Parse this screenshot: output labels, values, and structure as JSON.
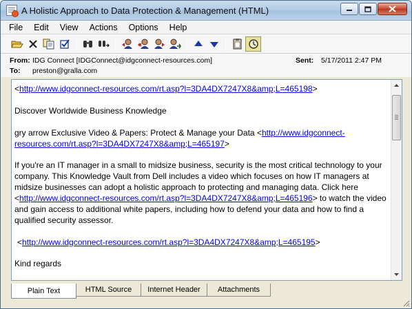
{
  "window": {
    "title": "A Holistic Approach to Data Protection & Management (HTML)",
    "controls": {
      "minimize": "—",
      "maximize": "▢",
      "close": "✕"
    }
  },
  "menu": [
    "File",
    "Edit",
    "View",
    "Actions",
    "Options",
    "Help"
  ],
  "toolbar": {
    "icons": [
      "open-folder-icon",
      "delete-icon",
      "copy-icon",
      "checkbox-icon",
      "search-binoculars-icon",
      "find-next-icon",
      "reply-icon",
      "reply-all-icon",
      "forward-icon",
      "forward-attach-icon",
      "previous-arrow-icon",
      "next-arrow-icon",
      "clipboard-icon",
      "clock-icon"
    ]
  },
  "header": {
    "from_label": "From:",
    "from_value": "IDG Connect  [IDGConnect@idgconnect-resources.com]",
    "to_label": "To:",
    "to_value": "preston@gralla.com",
    "sent_label": "Sent:",
    "sent_value": "5/17/2011 2:47 PM"
  },
  "body": {
    "link1_pre": "<",
    "link1": "http://www.idgconnect-resources.com/rt.asp?l=3DA4DX7247X8&amp;L=465198",
    "link1_post": ">",
    "discover": "Discover Worldwide Business Knowledge",
    "para2_pre": "gry arrow Exclusive Video & Papers: Protect & Manage your Data <",
    "link2": "http://www.idgconnect-resources.com/rt.asp?l=3DA4DX7247X8&amp;L=465197",
    "para2_post": ">",
    "para3_pre": "If you're an IT manager in a small to midsize business, security is the most critical technology to your company. This Knowledge Vault from Dell includes a video which focuses on how IT managers at midsize businesses can adopt a holistic approach to protecting and managing data. Click here <",
    "link3": "http://www.idgconnect-resources.com/rt.asp?l=3DA4DX7247X8&amp;L=465196",
    "para3_post": "> to watch the video and gain access to additional white papers, including how to defend your data and how to find a qualified security assessor.",
    "link4_pre": "<",
    "link4": "http://www.idgconnect-resources.com/rt.asp?l=3DA4DX7247X8&amp;L=465195",
    "link4_post": ">",
    "closing": "Kind regards"
  },
  "tabs": [
    "Plain Text",
    "HTML Source",
    "Internet Header",
    "Attachments"
  ],
  "colors": {
    "link": "#0000ee",
    "titlebar": "#b4cde6",
    "close_button": "#c8462f"
  }
}
